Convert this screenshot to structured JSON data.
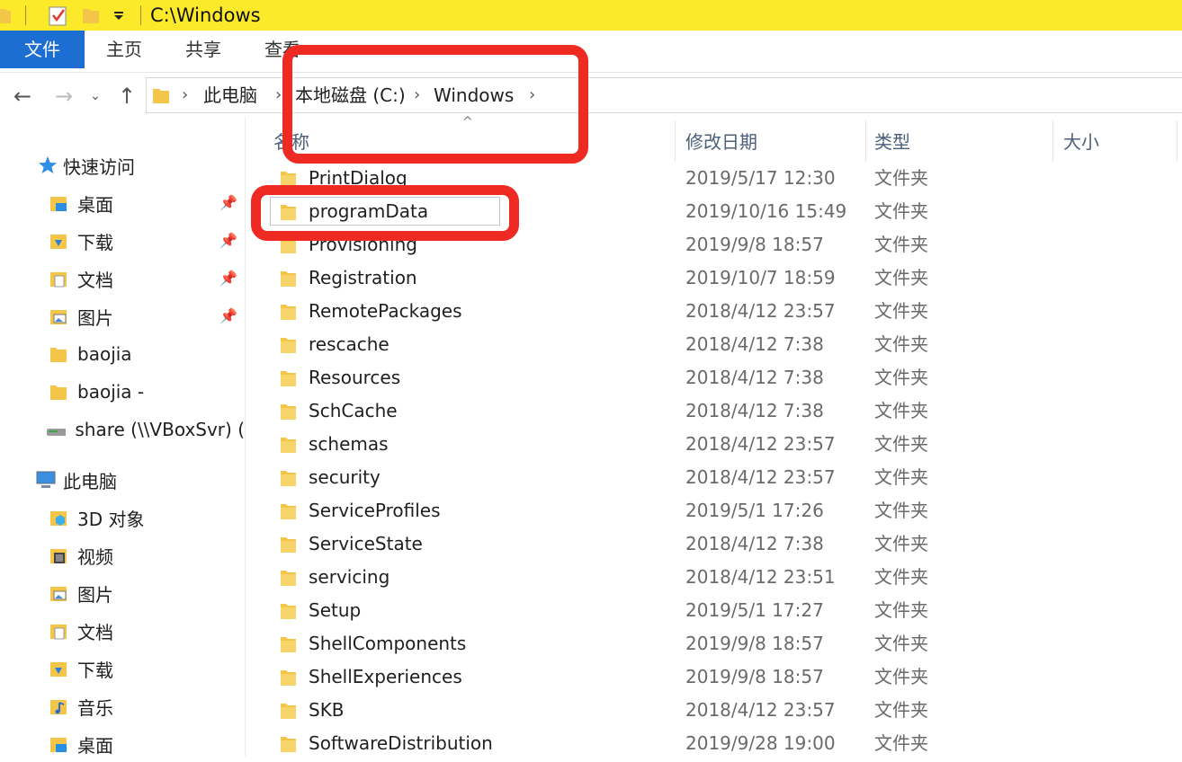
{
  "window": {
    "title": "C:\\Windows"
  },
  "ribbon": {
    "tabs": [
      "文件",
      "主页",
      "共享",
      "查看"
    ]
  },
  "address": {
    "crumbs": [
      "此电脑",
      "本地磁盘 (C:)",
      "Windows"
    ]
  },
  "columns": {
    "name": "名称",
    "date": "修改日期",
    "type": "类型",
    "size": "大小"
  },
  "sidebar": {
    "quick_access": "快速访问",
    "quick_items": [
      {
        "label": "桌面",
        "icon": "desktop-folder-icon",
        "pinned": true
      },
      {
        "label": "下载",
        "icon": "download-folder-icon",
        "pinned": true
      },
      {
        "label": "文档",
        "icon": "documents-folder-icon",
        "pinned": true
      },
      {
        "label": "图片",
        "icon": "pictures-folder-icon",
        "pinned": true
      },
      {
        "label": "baojia",
        "icon": "folder-icon",
        "pinned": false
      },
      {
        "label": "baojia -",
        "icon": "folder-icon",
        "pinned": false
      },
      {
        "label": "share (\\\\VBoxSvr) (",
        "icon": "network-drive-icon",
        "pinned": false
      }
    ],
    "this_pc": "此电脑",
    "pc_items": [
      {
        "label": "3D 对象",
        "icon": "3d-objects-icon"
      },
      {
        "label": "视频",
        "icon": "videos-folder-icon"
      },
      {
        "label": "图片",
        "icon": "pictures-folder-icon"
      },
      {
        "label": "文档",
        "icon": "documents-folder-icon"
      },
      {
        "label": "下载",
        "icon": "download-folder-icon"
      },
      {
        "label": "音乐",
        "icon": "music-folder-icon"
      },
      {
        "label": "桌面",
        "icon": "desktop-folder-icon"
      }
    ]
  },
  "files": [
    {
      "name": "PrintDialog",
      "date": "2019/5/17 12:30",
      "type": "文件夹"
    },
    {
      "name": "programData",
      "date": "2019/10/16 15:49",
      "type": "文件夹",
      "selected": true
    },
    {
      "name": "Provisioning",
      "date": "2019/9/8 18:57",
      "type": "文件夹"
    },
    {
      "name": "Registration",
      "date": "2019/10/7 18:59",
      "type": "文件夹"
    },
    {
      "name": "RemotePackages",
      "date": "2018/4/12 23:57",
      "type": "文件夹"
    },
    {
      "name": "rescache",
      "date": "2018/4/12 7:38",
      "type": "文件夹"
    },
    {
      "name": "Resources",
      "date": "2018/4/12 7:38",
      "type": "文件夹"
    },
    {
      "name": "SchCache",
      "date": "2018/4/12 7:38",
      "type": "文件夹"
    },
    {
      "name": "schemas",
      "date": "2018/4/12 23:57",
      "type": "文件夹"
    },
    {
      "name": "security",
      "date": "2018/4/12 23:57",
      "type": "文件夹"
    },
    {
      "name": "ServiceProfiles",
      "date": "2019/5/1 17:26",
      "type": "文件夹"
    },
    {
      "name": "ServiceState",
      "date": "2018/4/12 7:38",
      "type": "文件夹"
    },
    {
      "name": "servicing",
      "date": "2018/4/12 23:51",
      "type": "文件夹"
    },
    {
      "name": "Setup",
      "date": "2019/5/1 17:27",
      "type": "文件夹"
    },
    {
      "name": "ShellComponents",
      "date": "2019/9/8 18:57",
      "type": "文件夹"
    },
    {
      "name": "ShellExperiences",
      "date": "2019/9/8 18:57",
      "type": "文件夹"
    },
    {
      "name": "SKB",
      "date": "2018/4/12 23:57",
      "type": "文件夹"
    },
    {
      "name": "SoftwareDistribution",
      "date": "2019/9/28 19:00",
      "type": "文件夹"
    }
  ],
  "colors": {
    "titlebar": "#fbe92a",
    "file_tab": "#1c6ed2",
    "annotation": "#ef2a22",
    "folder": "#f3c64a"
  }
}
